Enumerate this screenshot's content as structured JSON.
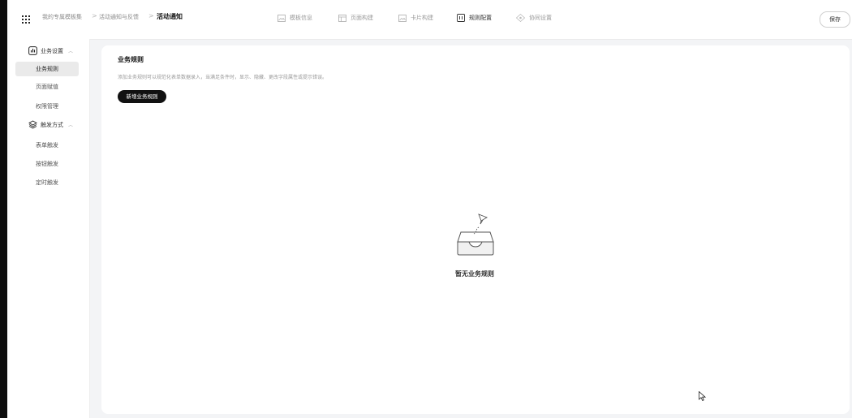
{
  "breadcrumb": {
    "root": "我的专属模板集",
    "parent": "活动通知与反馈",
    "current": "活动通知",
    "separator": ">"
  },
  "top_tabs": [
    {
      "label": "模板信息",
      "icon": "image-icon",
      "active": false
    },
    {
      "label": "页面构建",
      "icon": "layout-icon",
      "active": false
    },
    {
      "label": "卡片构建",
      "icon": "card-icon",
      "active": false
    },
    {
      "label": "规则配置",
      "icon": "rule-icon",
      "active": true
    },
    {
      "label": "协同设置",
      "icon": "collab-icon",
      "active": false
    }
  ],
  "save_label": "保存",
  "sidebar": {
    "group1": {
      "label": "业务设置",
      "icon": "chart-icon",
      "expanded": true
    },
    "group1_items": [
      "业务规则",
      "页面赋值",
      "权限管理"
    ],
    "group2": {
      "label": "触发方式",
      "icon": "layers-icon",
      "expanded": true
    },
    "group2_items": [
      "表单触发",
      "按钮触发",
      "定时触发"
    ],
    "active_item": "业务规则"
  },
  "main": {
    "title": "业务规则",
    "description": "添加业务规则可以规范化表单数据录入，当满足条件时，显示、隐藏、更改字段属性或提示错误。",
    "add_button": "新增业务规则",
    "empty_text": "暂无业务规则"
  },
  "colors": {
    "accent": "#111111",
    "background": "#f3f4f6",
    "active_item_bg": "#eaeaea"
  }
}
